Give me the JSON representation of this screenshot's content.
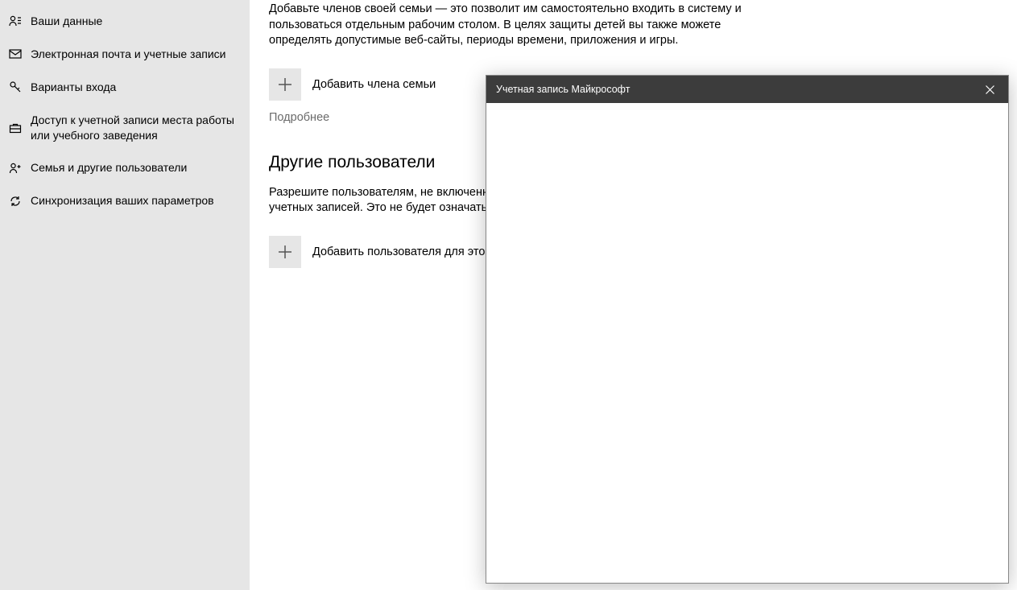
{
  "sidebar": {
    "items": [
      {
        "label": "Ваши данные"
      },
      {
        "label": "Электронная почта и учетные записи"
      },
      {
        "label": "Варианты входа"
      },
      {
        "label": "Доступ к учетной записи места работы или учебного заведения"
      },
      {
        "label": "Семья и другие пользователи"
      },
      {
        "label": "Синхронизация ваших параметров"
      }
    ]
  },
  "main": {
    "family_intro": "Добавьте членов своей семьи — это позволит им самостоятельно входить в систему и пользоваться отдельным рабочим столом. В целях защиты детей вы также можете определять допустимые веб-сайты, периоды времени, приложения и игры.",
    "add_family_label": "Добавить члена семьи",
    "learn_more": "Подробнее",
    "other_users_heading": "Другие пользователи",
    "other_users_body": "Разрешите пользователям, не включенным в семью, входить в систему с помощью их учетных записей. Это не будет означать их добавление в семью.",
    "add_other_label": "Добавить пользователя для этого компьютера"
  },
  "dialog": {
    "title": "Учетная запись Майкрософт"
  }
}
